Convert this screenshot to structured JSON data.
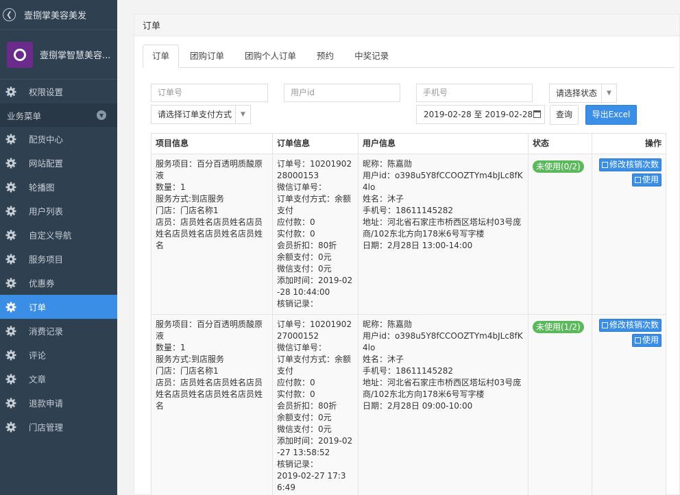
{
  "sidebar": {
    "back_title": "壹捌掌美容美发",
    "brand_name": "壹捌掌智慧美容...",
    "top_item": "权限设置",
    "section_label": "业务菜单",
    "items": [
      {
        "label": "配货中心",
        "icon": "gear-icon"
      },
      {
        "label": "网站配置",
        "icon": "gear-icon"
      },
      {
        "label": "轮播图",
        "icon": "gear-icon"
      },
      {
        "label": "用户列表",
        "icon": "gear-icon"
      },
      {
        "label": "自定义导航",
        "icon": "gear-icon"
      },
      {
        "label": "服务项目",
        "icon": "gear-icon"
      },
      {
        "label": "优惠券",
        "icon": "gear-icon"
      },
      {
        "label": "订单",
        "icon": "gear-icon",
        "active": true
      },
      {
        "label": "消费记录",
        "icon": "gear-icon"
      },
      {
        "label": "评论",
        "icon": "gear-icon"
      },
      {
        "label": "文章",
        "icon": "gear-icon"
      },
      {
        "label": "退款申请",
        "icon": "gear-icon"
      },
      {
        "label": "门店管理",
        "icon": "gear-icon"
      }
    ]
  },
  "panel": {
    "title": "订单",
    "tabs": [
      "订单",
      "团购订单",
      "团购个人订单",
      "预约",
      "中奖记录"
    ],
    "active_tab": 0
  },
  "filters": {
    "order_no_placeholder": "订单号",
    "user_id_placeholder": "用户id",
    "phone_placeholder": "手机号",
    "status_select": "请选择状态",
    "pay_method_select": "请选择订单支付方式",
    "date_range": "2019-02-28 至 2019-02-28",
    "query_label": "查询",
    "export_label": "导出Excel"
  },
  "table": {
    "headers": [
      "项目信息",
      "订单信息",
      "用户信息",
      "状态",
      "操作"
    ],
    "rows": [
      {
        "project": [
          "服务项目：百分百透明质酸原液",
          "数量：1",
          "服务方式:到店服务",
          "门店：门店名称1",
          "店员：店员姓名店员姓名店员姓名店员姓名店员姓名店员姓名"
        ],
        "order": [
          "订单号：1020190228000153",
          "微信订单号：",
          "订单支付方式：余额支付",
          "应付款：0",
          "实付款：0",
          "会员折扣：80折",
          "余额支付：0元",
          "微信支付：0元",
          "添加时间：2019-02-28 10:44:00",
          "核销记录："
        ],
        "user": [
          "昵称：陈嘉勋",
          "用户id：o398u5Y8fCCOOZTYm4bJLc8fK4lo",
          "姓名：沐子",
          "手机号：18611145282",
          "地址：河北省石家庄市桥西区塔坛村03号庞商/102东北方向178米6号写字楼",
          "日期：2月28日 13:00-14:00"
        ],
        "status": "未使用(0/2)",
        "op_edit": "修改核销次数",
        "op_use": "使用"
      },
      {
        "project": [
          "服务项目：百分百透明质酸原液",
          "数量：1",
          "服务方式:到店服务",
          "门店：门店名称1",
          "店员：店员姓名店员姓名店员姓名店员姓名店员姓名店员姓名"
        ],
        "order": [
          "订单号：1020190227000152",
          "微信订单号：",
          "订单支付方式：余额支付",
          "应付款：0",
          "实付款：0",
          "会员折扣：80折",
          "余额支付：0元",
          "微信支付：0元",
          "添加时间：2019-02-27 13:58:52",
          "核销记录：",
          "2019-02-27 17:36:49"
        ],
        "user": [
          "昵称：陈嘉勋",
          "用户id：o398u5Y8fCCOOZTYm4bJLc8fK4lo",
          "姓名：沐子",
          "手机号：18611145282",
          "地址：河北省石家庄市桥西区塔坛村03号庞商/102东北方向178米6号写字楼",
          "日期：2月28日 09:00-10:00"
        ],
        "status": "未使用(1/2)",
        "op_edit": "修改核销次数",
        "op_use": "使用"
      }
    ]
  },
  "colors": {
    "sidebar_bg": "#2f4050",
    "active_bg": "#3a8ee6",
    "badge_green": "#5cb85c",
    "primary": "#3a8ee6"
  }
}
